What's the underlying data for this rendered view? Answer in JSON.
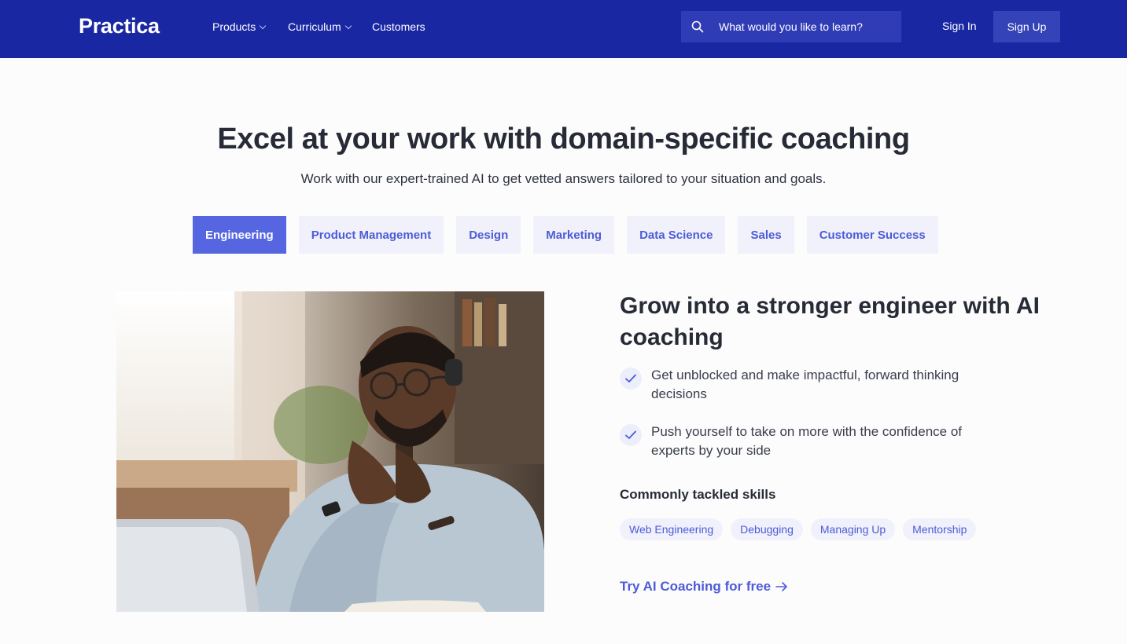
{
  "nav": {
    "logo": "Practica",
    "links": [
      {
        "label": "Products"
      },
      {
        "label": "Curriculum"
      },
      {
        "label": "Customers"
      }
    ],
    "search_placeholder": "What would you like to learn?",
    "sign_in": "Sign In",
    "sign_up": "Sign Up"
  },
  "hero": {
    "title": "Excel at your work with domain-specific coaching",
    "subtitle": "Work with our expert-trained AI to get vetted answers tailored to your situation and goals."
  },
  "tabs": [
    {
      "label": "Engineering",
      "active": true
    },
    {
      "label": "Product Management"
    },
    {
      "label": "Design"
    },
    {
      "label": "Marketing"
    },
    {
      "label": "Data Science"
    },
    {
      "label": "Sales"
    },
    {
      "label": "Customer Success"
    }
  ],
  "feature": {
    "title": "Grow into a stronger engineer with AI coaching",
    "benefits": [
      "Get unblocked and make impactful, forward thinking decisions",
      "Push yourself to take on more with the confidence of experts by your side"
    ],
    "skills_heading": "Commonly tackled skills",
    "skills": [
      "Web Engineering",
      "Debugging",
      "Managing Up",
      "Mentorship"
    ],
    "cta": "Try AI Coaching for free"
  },
  "colors": {
    "nav_bg": "#1a27a3",
    "accent": "#5566e0",
    "link": "#4d5bd8"
  }
}
